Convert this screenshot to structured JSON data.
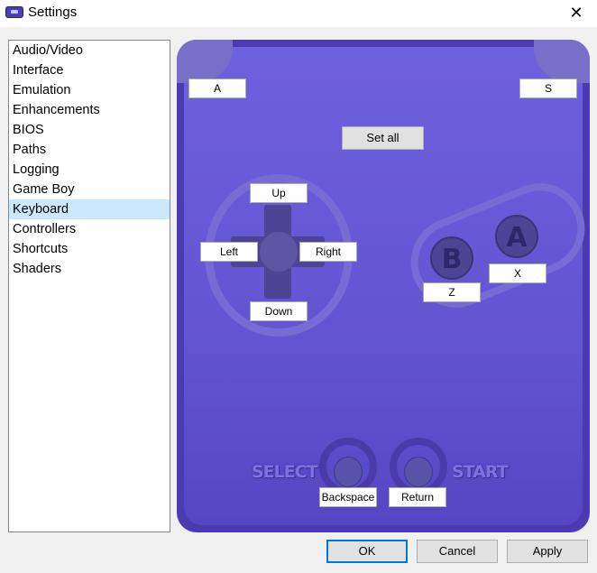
{
  "window": {
    "title": "Settings",
    "close_glyph": "✕"
  },
  "sidebar": {
    "items": [
      {
        "label": "Audio/Video"
      },
      {
        "label": "Interface"
      },
      {
        "label": "Emulation"
      },
      {
        "label": "Enhancements"
      },
      {
        "label": "BIOS"
      },
      {
        "label": "Paths"
      },
      {
        "label": "Logging"
      },
      {
        "label": "Game Boy"
      },
      {
        "label": "Keyboard",
        "selected": true
      },
      {
        "label": "Controllers"
      },
      {
        "label": "Shortcuts"
      },
      {
        "label": "Shaders"
      }
    ]
  },
  "gamepad": {
    "set_all_label": "Set all",
    "bindings": {
      "l": "A",
      "r": "S",
      "up": "Up",
      "left": "Left",
      "right": "Right",
      "down": "Down",
      "a": "X",
      "b": "Z",
      "select": "Backspace",
      "start": "Return"
    },
    "face_buttons": {
      "a": "A",
      "b": "B"
    },
    "select_text": "SELECT",
    "start_text": "START",
    "colors": {
      "body": "#6354d1",
      "border": "#4c3bb0",
      "accent": "#786bd6"
    }
  },
  "footer": {
    "ok_label": "OK",
    "cancel_label": "Cancel",
    "apply_label": "Apply"
  }
}
